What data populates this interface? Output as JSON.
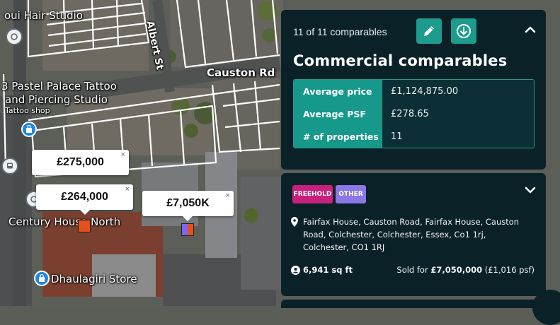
{
  "map": {
    "labels": {
      "hair_studio": "oui Hair Studio",
      "albert_st": "Albert St",
      "causton_rd": "Causton Rd",
      "tattoo_line1": "3 Pastel Palace Tattoo",
      "tattoo_line2": "and Piercing Studio",
      "tattoo_type": "Tattoo shop",
      "century_house": "Century House North",
      "dhaulagiri": "Dhaulagiri Store"
    },
    "price_tags": [
      {
        "price": "£275,000",
        "close": "×"
      },
      {
        "price": "£264,000",
        "close": "×"
      },
      {
        "price": "£7,050K",
        "close": "×"
      }
    ],
    "marker_colors": {
      "orange": "#e4511b",
      "split_left": "#7b68ee",
      "split_right": "#e4511b"
    }
  },
  "summary": {
    "count_text": "11 of 11 comparables",
    "title": "Commercial comparables",
    "stats": [
      {
        "label": "Average price",
        "value": "£1,124,875.00"
      },
      {
        "label": "Average PSF",
        "value": "£278.65"
      },
      {
        "label": "# of properties",
        "value": "11"
      }
    ],
    "icons": {
      "edit": "pencil-icon",
      "download": "download-icon",
      "collapse": "chevron-up-icon"
    },
    "accent_color": "#1d9c8e"
  },
  "property": {
    "badges": {
      "freehold": "FREEHOLD",
      "other": "OTHER"
    },
    "address": "Fairfax House, Causton Road, Fairfax House, Causton Road, Colchester, Colchester, Essex, Co1 1rj, Colchester, CO1 1RJ",
    "area": "6,941 sq ft",
    "sold_prefix": "Sold for",
    "sold_price": "£7,050,000",
    "sold_psf": "(£1,016 psf)",
    "badge_colors": {
      "freehold": "#c7207d",
      "other": "#8b78e6"
    }
  }
}
